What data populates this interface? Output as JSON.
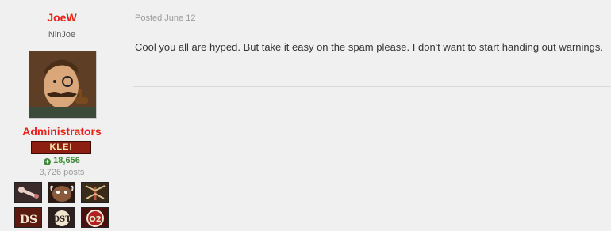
{
  "author": {
    "username": "JoeW",
    "title": "NinJoe",
    "group": "Administrators",
    "rank_badge": "KLEI",
    "reputation": "18,656",
    "reputation_icon": "plus-circle-icon",
    "post_count": "3,726 posts",
    "badges": [
      {
        "name": "bone-key-badge"
      },
      {
        "name": "beefalo-badge"
      },
      {
        "name": "mosquito-badge"
      },
      {
        "name": "ds-logo-badge"
      },
      {
        "name": "dst-logo-badge"
      },
      {
        "name": "oni-logo-badge"
      }
    ]
  },
  "post": {
    "posted": "Posted June 12",
    "body": "Cool you all are hyped. But take it easy on the spam please. I don't want to start handing out warnings.",
    "signature": "."
  },
  "colors": {
    "accent_red": "#e8221b",
    "reputation_green": "#3d8b36",
    "background": "#f0f0f0"
  }
}
